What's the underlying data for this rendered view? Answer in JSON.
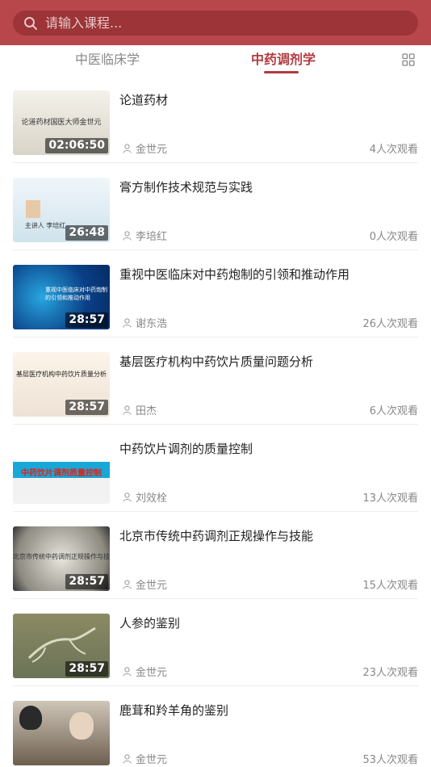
{
  "search": {
    "placeholder": "请输入课程..."
  },
  "tabs": [
    {
      "label": "中医临床学",
      "active": false
    },
    {
      "label": "中药调剂学",
      "active": true
    }
  ],
  "colors": {
    "accent": "#b23a41",
    "header": "#b8474c"
  },
  "courses": [
    {
      "title": "论道药材",
      "teacher": "金世元",
      "views": "4人次观看",
      "duration": "02:06:50",
      "thumb_text": "论道药材国医大师金世元"
    },
    {
      "title": "膏方制作技术规范与实践",
      "teacher": "李培红",
      "views": "0人次观看",
      "duration": "26:48",
      "thumb_text": "主讲人 李培红"
    },
    {
      "title": "重视中医临床对中药炮制的引领和推动作用",
      "teacher": "谢东浩",
      "views": "26人次观看",
      "duration": "28:57",
      "thumb_text": "重视中医临床对中药炮制的引领和推动作用"
    },
    {
      "title": "基层医疗机构中药饮片质量问题分析",
      "teacher": "田杰",
      "views": "6人次观看",
      "duration": "28:57",
      "thumb_text": "基层医疗机构中药饮片质量分析"
    },
    {
      "title": "中药饮片调剂的质量控制",
      "teacher": "刘效栓",
      "views": "13人次观看",
      "duration": "",
      "thumb_text": "中药饮片调剂质量控制"
    },
    {
      "title": "北京市传统中药调剂正规操作与技能",
      "teacher": "金世元",
      "views": "15人次观看",
      "duration": "28:57",
      "thumb_text": "北京市传统中药调剂正规操作与技能"
    },
    {
      "title": "人参的鉴别",
      "teacher": "金世元",
      "views": "23人次观看",
      "duration": "28:57",
      "thumb_text": ""
    },
    {
      "title": "鹿茸和羚羊角的鉴别",
      "teacher": "金世元",
      "views": "53人次观看",
      "duration": "",
      "thumb_text": ""
    }
  ]
}
